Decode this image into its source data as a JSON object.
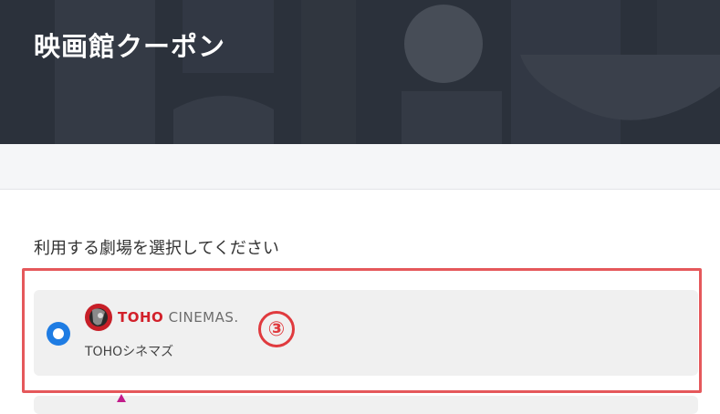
{
  "header": {
    "title": "映画館クーポン"
  },
  "form": {
    "section_label": "利用する劇場を選択してください",
    "theaters": [
      {
        "name": "TOHOシネマズ",
        "logo_text_primary": "TOHO",
        "logo_text_secondary": "CINEMAS.",
        "selected": true
      }
    ]
  },
  "annotation": {
    "step_marker": "③",
    "color": "#e03a3e",
    "box_color": "#e5585b"
  },
  "colors": {
    "header_bg": "#2b313b",
    "radio_selected": "#1e7ce3",
    "card_bg": "#f0f0f0",
    "logo_red": "#d2202a"
  }
}
